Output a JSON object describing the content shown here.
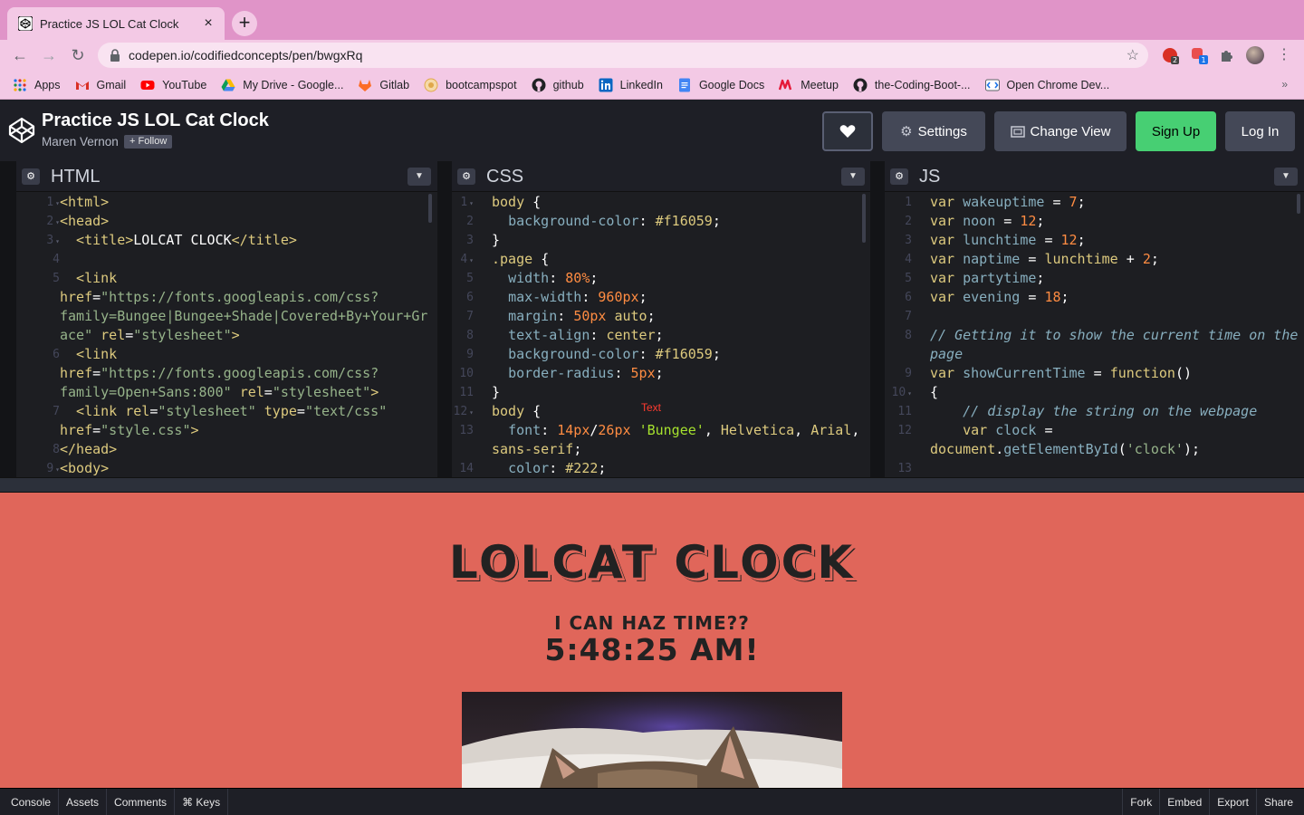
{
  "browser": {
    "tab_title": "Practice JS LOL Cat Clock",
    "tab_close": "×",
    "new_tab": "+",
    "url": "codepen.io/codifiedconcepts/pen/bwgxRq",
    "ext_badge_1": "2",
    "ext_badge_2": "1",
    "bookmarks": [
      {
        "label": "Apps",
        "icon": "apps-grid-icon"
      },
      {
        "label": "Gmail",
        "icon": "gmail-icon"
      },
      {
        "label": "YouTube",
        "icon": "youtube-icon"
      },
      {
        "label": "My Drive - Google...",
        "icon": "google-drive-icon"
      },
      {
        "label": "Gitlab",
        "icon": "gitlab-icon"
      },
      {
        "label": "bootcampspot",
        "icon": "bootcampspot-icon"
      },
      {
        "label": "github",
        "icon": "github-icon"
      },
      {
        "label": "LinkedIn",
        "icon": "linkedin-icon"
      },
      {
        "label": "Google Docs",
        "icon": "google-docs-icon"
      },
      {
        "label": "Meetup",
        "icon": "meetup-icon"
      },
      {
        "label": "the-Coding-Boot-...",
        "icon": "github-icon"
      },
      {
        "label": "Open Chrome Dev...",
        "icon": "chrome-dev-icon"
      }
    ],
    "bookmarks_more": "»"
  },
  "codepen": {
    "pen_title": "Practice JS LOL Cat Clock",
    "author": "Maren Vernon",
    "follow": "+ Follow",
    "settings": "Settings",
    "change_view": "Change View",
    "sign_up": "Sign Up",
    "log_in": "Log In",
    "colors": {
      "signup": "#47cf73",
      "preview_bg": "#e0665a"
    }
  },
  "panels": {
    "html": {
      "title": "HTML",
      "line_numbers": [
        "1",
        "2",
        "3",
        "4",
        "5",
        "",
        "",
        "6",
        "",
        "7",
        "",
        "8",
        "9"
      ],
      "lines": [
        "<html>",
        "<head>",
        "  <title>LOLCAT CLOCK</title>",
        "",
        "  <link",
        "href=\"https://fonts.googleapis.com/css?",
        "family=Bungee|Bungee+Shade|Covered+By+Your+Gr",
        "ace\" rel=\"stylesheet\">",
        "  <link",
        "href=\"https://fonts.googleapis.com/css?",
        "family=Open+Sans:800\" rel=\"stylesheet\">",
        "  <link rel=\"stylesheet\" type=\"text/css\"",
        "href=\"style.css\">",
        "</head>",
        "<body>"
      ]
    },
    "css": {
      "title": "CSS",
      "lines": [
        "body {",
        "  background-color: #f16059;",
        "}",
        ".page {",
        "  width: 80%;",
        "  max-width: 960px;",
        "  margin: 50px auto;",
        "  text-align: center;",
        "  background-color: #f16059;",
        "  border-radius: 5px;",
        "}",
        "body {",
        "  font: 14px/26px 'Bungee', Helvetica, Arial,",
        "sans-serif;",
        "  color: #222;"
      ],
      "tooltip": "Text"
    },
    "js": {
      "title": "JS",
      "lines": [
        "var wakeuptime = 7;",
        "var noon = 12;",
        "var lunchtime = 12;",
        "var naptime = lunchtime + 2;",
        "var partytime;",
        "var evening = 18;",
        "",
        "// Getting it to show the current time on the",
        "page",
        "var showCurrentTime = function()",
        "{",
        "    // display the string on the webpage",
        "    var clock =",
        "document.getElementById('clock');",
        ""
      ]
    }
  },
  "preview": {
    "title": "LOLCAT CLOCK",
    "subtitle": "I CAN HAZ TIME??",
    "time": "5:48:25 AM!"
  },
  "footer": {
    "left": [
      "Console",
      "Assets",
      "Comments",
      "⌘ Keys"
    ],
    "right": [
      "Fork",
      "Embed",
      "Export",
      "Share"
    ]
  }
}
